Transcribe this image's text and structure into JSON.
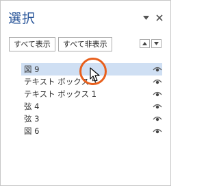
{
  "pane": {
    "title": "選択",
    "dropdown_icon": "triangle-down-icon",
    "close_icon": "close-icon"
  },
  "toolbar": {
    "show_all_label": "すべて表示",
    "hide_all_label": "すべて非表示",
    "bring_forward_icon": "triangle-up-icon",
    "send_backward_icon": "triangle-down-icon"
  },
  "items": [
    {
      "label": "図 9",
      "selected": true,
      "icon": "eye-icon"
    },
    {
      "label": "テキスト ボックス 5",
      "selected": false,
      "icon": "eye-icon"
    },
    {
      "label": "テキスト ボックス 1",
      "selected": false,
      "icon": "eye-icon"
    },
    {
      "label": "弦 4",
      "selected": false,
      "icon": "eye-icon"
    },
    {
      "label": "弦 3",
      "selected": false,
      "icon": "eye-icon"
    },
    {
      "label": "図 6",
      "selected": false,
      "icon": "eye-icon"
    }
  ],
  "colors": {
    "title": "#2b579a",
    "selection": "#cfdff3",
    "highlight_ring": "#e85f1c"
  }
}
